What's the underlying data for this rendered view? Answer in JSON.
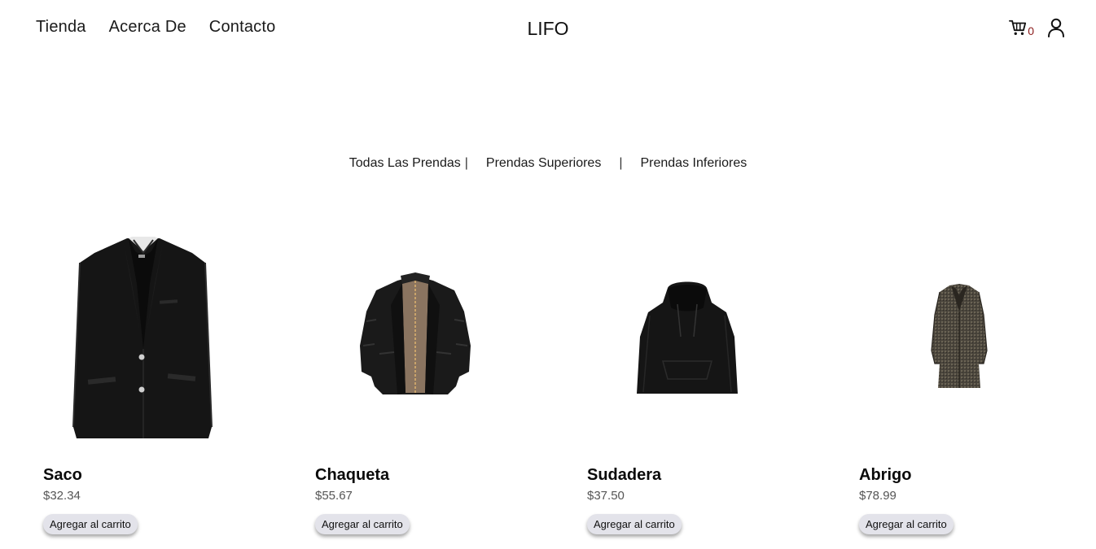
{
  "nav": {
    "links": [
      {
        "label": "Tienda"
      },
      {
        "label": "Acerca De"
      },
      {
        "label": "Contacto"
      }
    ],
    "brand": "LIFO",
    "cart_count": "0",
    "cart_icon": "cart-icon",
    "user_icon": "user-icon"
  },
  "filters": {
    "all": "Todas Las Prendas",
    "tops": "Prendas Superiores",
    "bottoms": "Prendas Inferiores",
    "separator": "|"
  },
  "products": [
    {
      "name": "Saco",
      "price": "$32.34",
      "button": "Agregar al carrito",
      "image": "black-blazer"
    },
    {
      "name": "Chaqueta",
      "price": "$55.67",
      "button": "Agregar al carrito",
      "image": "black-jacket"
    },
    {
      "name": "Sudadera",
      "price": "$37.50",
      "button": "Agregar al carrito",
      "image": "black-hoodie"
    },
    {
      "name": "Abrigo",
      "price": "$78.99",
      "button": "Agregar al carrito",
      "image": "tweed-coat"
    }
  ],
  "colors": {
    "cart_count": "#8b1a1a",
    "button_bg": "#e3e3ea",
    "price": "#555555"
  }
}
